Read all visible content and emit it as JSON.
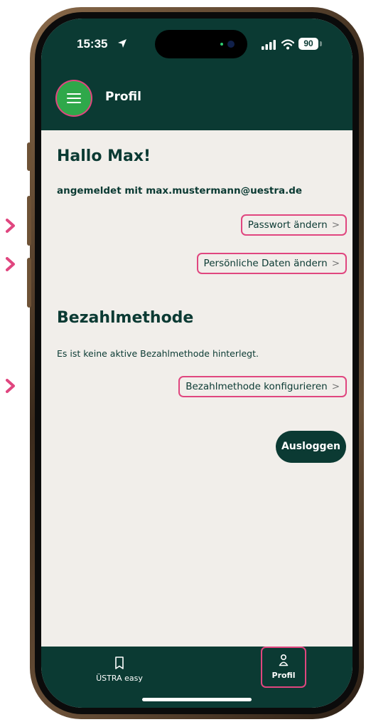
{
  "status_bar": {
    "time": "15:35",
    "battery": "90"
  },
  "header": {
    "title": "Profil"
  },
  "profile": {
    "greeting": "Hallo Max!",
    "login_info": "angemeldet mit max.mustermann@uestra.de",
    "change_password": "Passwort ändern",
    "change_personal_data": "Persönliche Daten ändern"
  },
  "payment": {
    "title": "Bezahlmethode",
    "info": "Es ist keine aktive Bezahlmethode hinterlegt.",
    "configure": "Bezahlmethode konfigurieren"
  },
  "logout_label": "Ausloggen",
  "bottom_nav": [
    {
      "label": "ÜSTRA easy",
      "icon": "ticket-icon"
    },
    {
      "label": "Profil",
      "icon": "person-icon",
      "active": true
    }
  ],
  "colors": {
    "primary_dark": "#0b3a33",
    "accent_green": "#2fa84a",
    "highlight_pink": "#e0467f",
    "background": "#f1eeea"
  }
}
